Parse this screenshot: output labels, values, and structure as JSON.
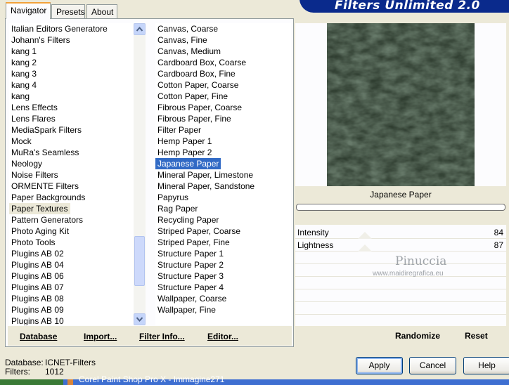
{
  "tabs": [
    {
      "label": "Navigator",
      "active": true
    },
    {
      "label": "Presets",
      "active": false
    },
    {
      "label": "About",
      "active": false
    }
  ],
  "banner": {
    "title": "Filters Unlimited 2.0"
  },
  "categories": [
    "Italian Editors Generatore",
    "Johann's Filters",
    "kang 1",
    "kang 2",
    "kang 3",
    "kang 4",
    "kang",
    "Lens Effects",
    "Lens Flares",
    "MediaSpark Filters",
    "Mock",
    "MuRa's Seamless",
    "Neology",
    "Noise Filters",
    "ORMENTE Filters",
    "Paper Backgrounds",
    "Paper Textures",
    "Pattern Generators",
    "Photo Aging Kit",
    "Photo Tools",
    "Plugins AB 02",
    "Plugins AB 04",
    "Plugins AB 06",
    "Plugins AB 07",
    "Plugins AB 08",
    "Plugins AB 09",
    "Plugins AB 10"
  ],
  "selected_category": "Paper Textures",
  "filters": [
    "Canvas, Coarse",
    "Canvas, Fine",
    "Canvas, Medium",
    "Cardboard Box, Coarse",
    "Cardboard Box, Fine",
    "Cotton Paper, Coarse",
    "Cotton Paper, Fine",
    "Fibrous Paper, Coarse",
    "Fibrous Paper, Fine",
    "Filter Paper",
    "Hemp Paper 1",
    "Hemp Paper 2",
    "Japanese Paper",
    "Mineral Paper, Limestone",
    "Mineral Paper, Sandstone",
    "Papyrus",
    "Rag Paper",
    "Recycling Paper",
    "Striped Paper, Coarse",
    "Striped Paper, Fine",
    "Structure Paper 1",
    "Structure Paper 2",
    "Structure Paper 3",
    "Structure Paper 4",
    "Wallpaper, Coarse",
    "Wallpaper, Fine"
  ],
  "selected_filter": "Japanese Paper",
  "navigator_buttons": {
    "database": "Database",
    "import": "Import...",
    "filter_info": "Filter Info...",
    "editor": "Editor..."
  },
  "preview": {
    "filter_title": "Japanese Paper",
    "texture_color": "#2f3d30"
  },
  "controls": [
    {
      "label": "Intensity",
      "value": "84"
    },
    {
      "label": "Lightness",
      "value": "87"
    }
  ],
  "watermark": {
    "name": "Pinuccia",
    "url": "www.maidiregrafica.eu"
  },
  "right_buttons": {
    "randomize": "Randomize",
    "reset": "Reset"
  },
  "status": {
    "database_label": "Database:",
    "database_value": "ICNET-Filters",
    "filters_label": "Filters:",
    "filters_value": "1012"
  },
  "dialog_buttons": {
    "apply": "Apply",
    "cancel": "Cancel",
    "help": "Help"
  },
  "taskbar_text": "Corel Paint Shop Pro X - Immagine271"
}
